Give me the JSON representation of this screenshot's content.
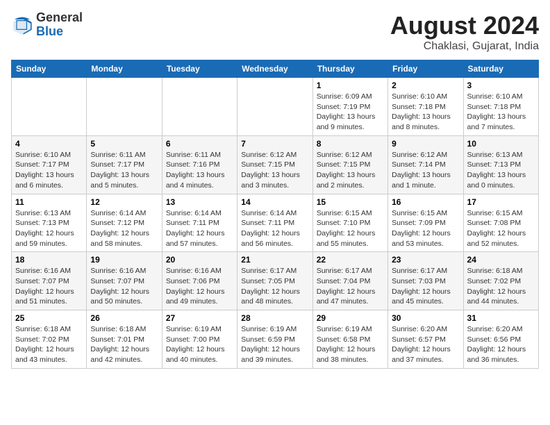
{
  "header": {
    "logo_general": "General",
    "logo_blue": "Blue",
    "month_title": "August 2024",
    "location": "Chaklasi, Gujarat, India"
  },
  "weekdays": [
    "Sunday",
    "Monday",
    "Tuesday",
    "Wednesday",
    "Thursday",
    "Friday",
    "Saturday"
  ],
  "weeks": [
    [
      {
        "day": "",
        "info": ""
      },
      {
        "day": "",
        "info": ""
      },
      {
        "day": "",
        "info": ""
      },
      {
        "day": "",
        "info": ""
      },
      {
        "day": "1",
        "info": "Sunrise: 6:09 AM\nSunset: 7:19 PM\nDaylight: 13 hours\nand 9 minutes."
      },
      {
        "day": "2",
        "info": "Sunrise: 6:10 AM\nSunset: 7:18 PM\nDaylight: 13 hours\nand 8 minutes."
      },
      {
        "day": "3",
        "info": "Sunrise: 6:10 AM\nSunset: 7:18 PM\nDaylight: 13 hours\nand 7 minutes."
      }
    ],
    [
      {
        "day": "4",
        "info": "Sunrise: 6:10 AM\nSunset: 7:17 PM\nDaylight: 13 hours\nand 6 minutes."
      },
      {
        "day": "5",
        "info": "Sunrise: 6:11 AM\nSunset: 7:17 PM\nDaylight: 13 hours\nand 5 minutes."
      },
      {
        "day": "6",
        "info": "Sunrise: 6:11 AM\nSunset: 7:16 PM\nDaylight: 13 hours\nand 4 minutes."
      },
      {
        "day": "7",
        "info": "Sunrise: 6:12 AM\nSunset: 7:15 PM\nDaylight: 13 hours\nand 3 minutes."
      },
      {
        "day": "8",
        "info": "Sunrise: 6:12 AM\nSunset: 7:15 PM\nDaylight: 13 hours\nand 2 minutes."
      },
      {
        "day": "9",
        "info": "Sunrise: 6:12 AM\nSunset: 7:14 PM\nDaylight: 13 hours\nand 1 minute."
      },
      {
        "day": "10",
        "info": "Sunrise: 6:13 AM\nSunset: 7:13 PM\nDaylight: 13 hours\nand 0 minutes."
      }
    ],
    [
      {
        "day": "11",
        "info": "Sunrise: 6:13 AM\nSunset: 7:13 PM\nDaylight: 12 hours\nand 59 minutes."
      },
      {
        "day": "12",
        "info": "Sunrise: 6:14 AM\nSunset: 7:12 PM\nDaylight: 12 hours\nand 58 minutes."
      },
      {
        "day": "13",
        "info": "Sunrise: 6:14 AM\nSunset: 7:11 PM\nDaylight: 12 hours\nand 57 minutes."
      },
      {
        "day": "14",
        "info": "Sunrise: 6:14 AM\nSunset: 7:11 PM\nDaylight: 12 hours\nand 56 minutes."
      },
      {
        "day": "15",
        "info": "Sunrise: 6:15 AM\nSunset: 7:10 PM\nDaylight: 12 hours\nand 55 minutes."
      },
      {
        "day": "16",
        "info": "Sunrise: 6:15 AM\nSunset: 7:09 PM\nDaylight: 12 hours\nand 53 minutes."
      },
      {
        "day": "17",
        "info": "Sunrise: 6:15 AM\nSunset: 7:08 PM\nDaylight: 12 hours\nand 52 minutes."
      }
    ],
    [
      {
        "day": "18",
        "info": "Sunrise: 6:16 AM\nSunset: 7:07 PM\nDaylight: 12 hours\nand 51 minutes."
      },
      {
        "day": "19",
        "info": "Sunrise: 6:16 AM\nSunset: 7:07 PM\nDaylight: 12 hours\nand 50 minutes."
      },
      {
        "day": "20",
        "info": "Sunrise: 6:16 AM\nSunset: 7:06 PM\nDaylight: 12 hours\nand 49 minutes."
      },
      {
        "day": "21",
        "info": "Sunrise: 6:17 AM\nSunset: 7:05 PM\nDaylight: 12 hours\nand 48 minutes."
      },
      {
        "day": "22",
        "info": "Sunrise: 6:17 AM\nSunset: 7:04 PM\nDaylight: 12 hours\nand 47 minutes."
      },
      {
        "day": "23",
        "info": "Sunrise: 6:17 AM\nSunset: 7:03 PM\nDaylight: 12 hours\nand 45 minutes."
      },
      {
        "day": "24",
        "info": "Sunrise: 6:18 AM\nSunset: 7:02 PM\nDaylight: 12 hours\nand 44 minutes."
      }
    ],
    [
      {
        "day": "25",
        "info": "Sunrise: 6:18 AM\nSunset: 7:02 PM\nDaylight: 12 hours\nand 43 minutes."
      },
      {
        "day": "26",
        "info": "Sunrise: 6:18 AM\nSunset: 7:01 PM\nDaylight: 12 hours\nand 42 minutes."
      },
      {
        "day": "27",
        "info": "Sunrise: 6:19 AM\nSunset: 7:00 PM\nDaylight: 12 hours\nand 40 minutes."
      },
      {
        "day": "28",
        "info": "Sunrise: 6:19 AM\nSunset: 6:59 PM\nDaylight: 12 hours\nand 39 minutes."
      },
      {
        "day": "29",
        "info": "Sunrise: 6:19 AM\nSunset: 6:58 PM\nDaylight: 12 hours\nand 38 minutes."
      },
      {
        "day": "30",
        "info": "Sunrise: 6:20 AM\nSunset: 6:57 PM\nDaylight: 12 hours\nand 37 minutes."
      },
      {
        "day": "31",
        "info": "Sunrise: 6:20 AM\nSunset: 6:56 PM\nDaylight: 12 hours\nand 36 minutes."
      }
    ]
  ]
}
